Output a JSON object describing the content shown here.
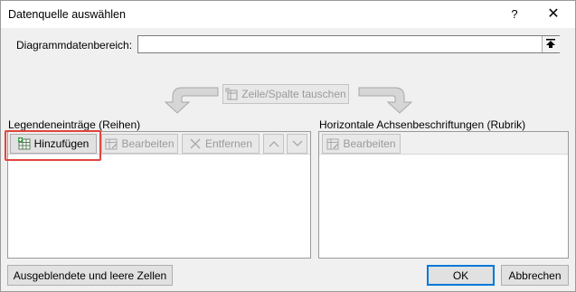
{
  "window": {
    "title": "Datenquelle auswählen",
    "help_glyph": "?",
    "close_glyph": "✕"
  },
  "range": {
    "label": "Diagrammdatenbereich:",
    "value": ""
  },
  "switch_button": {
    "label": "Zeile/Spalte tauschen"
  },
  "legend_panel": {
    "heading": "Legendeneinträge (Reihen)",
    "add_label": "Hinzufügen",
    "edit_label": "Bearbeiten",
    "remove_label": "Entfernen",
    "items": []
  },
  "axis_panel": {
    "heading": "Horizontale Achsenbeschriftungen (Rubrik)",
    "edit_label": "Bearbeiten",
    "items": []
  },
  "footer": {
    "hidden_cells_label": "Ausgeblendete und leere Zellen",
    "ok_label": "OK",
    "cancel_label": "Abbrechen"
  },
  "colors": {
    "highlight": "#e0463e",
    "focus": "#0078d7"
  }
}
